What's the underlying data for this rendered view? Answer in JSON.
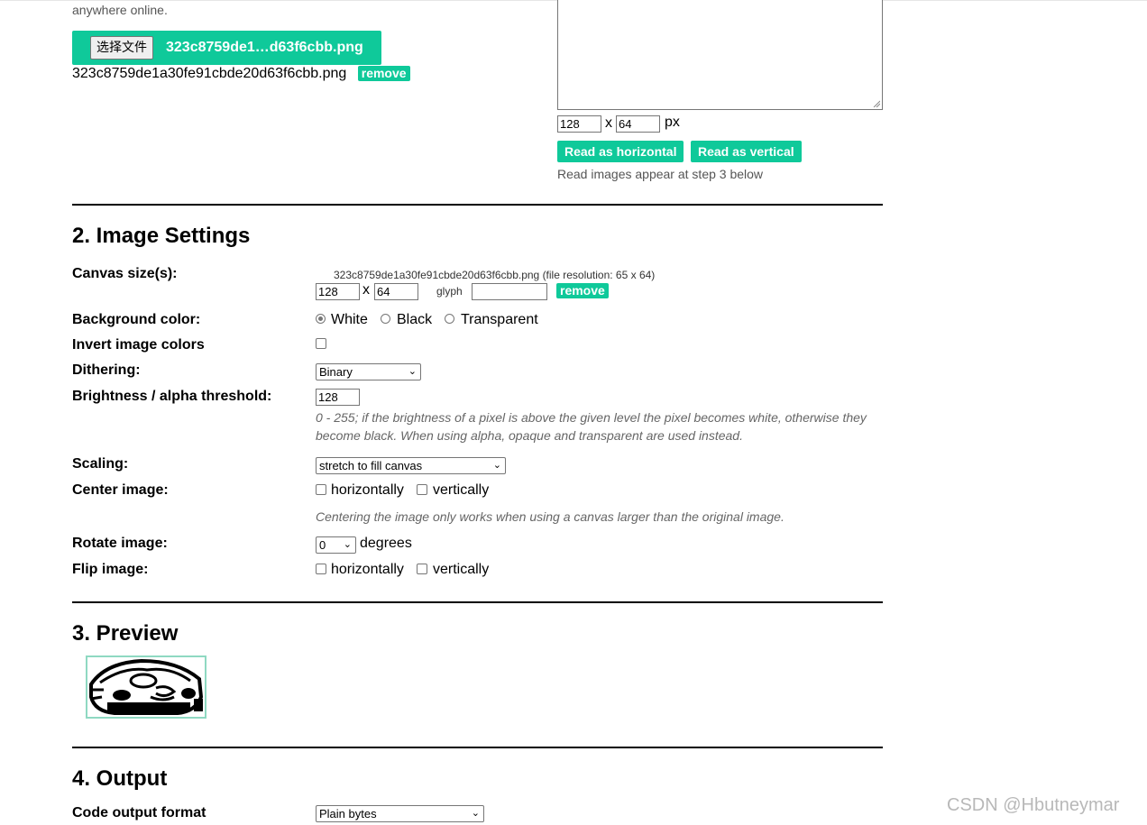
{
  "upload": {
    "tagline": "anywhere online.",
    "choose_button": "选择文件",
    "chosen_file_short": "323c8759de1…d63f6cbb.png",
    "file_name": "323c8759de1a30fe91cbde20d63f6cbb.png",
    "remove_label": "remove"
  },
  "byte_reader": {
    "width": "128",
    "x_sep": "x",
    "height": "64",
    "unit": "px",
    "read_horizontal": "Read as horizontal",
    "read_vertical": "Read as vertical",
    "note": "Read images appear at step 3 below"
  },
  "settings": {
    "heading": "2. Image Settings",
    "canvas_label": "Canvas size(s):",
    "canvas_file": "323c8759de1a30fe91cbde20d63f6cbb.png",
    "canvas_resolution": "(file resolution: 65 x 64)",
    "canvas_width": "128",
    "canvas_x": "x",
    "canvas_height": "64",
    "glyph_label": "glyph",
    "glyph_value": "",
    "canvas_remove": "remove",
    "background_label": "Background color:",
    "bg_options": [
      "White",
      "Black",
      "Transparent"
    ],
    "bg_selected": "White",
    "invert_label": "Invert image colors",
    "invert_checked": false,
    "dithering_label": "Dithering:",
    "dithering_value": "Binary",
    "brightness_label": "Brightness / alpha threshold:",
    "brightness_value": "128",
    "brightness_hint_1": "0 - 255; if the brightness of a pixel is above the given level the pixel becomes white, otherwise they",
    "brightness_hint_2": "become black. When using alpha, opaque and transparent are used instead.",
    "scaling_label": "Scaling:",
    "scaling_value": "stretch to fill canvas",
    "center_label": "Center image:",
    "center_h": "horizontally",
    "center_v": "vertically",
    "center_hint": "Centering the image only works when using a canvas larger than the original image.",
    "rotate_label": "Rotate image:",
    "rotate_value": "0",
    "rotate_unit": "degrees",
    "flip_label": "Flip image:",
    "flip_h": "horizontally",
    "flip_v": "vertically"
  },
  "preview": {
    "heading": "3. Preview"
  },
  "output": {
    "heading": "4. Output",
    "format_label": "Code output format",
    "format_value": "Plain bytes"
  },
  "watermark": "CSDN @Hbutneymar",
  "colors": {
    "accent": "#0fc99a",
    "preview_border": "#8fd9c2"
  },
  "icons": {
    "select_arrow": "chevron-down-icon",
    "textarea_resize": "resize-grip-icon"
  }
}
